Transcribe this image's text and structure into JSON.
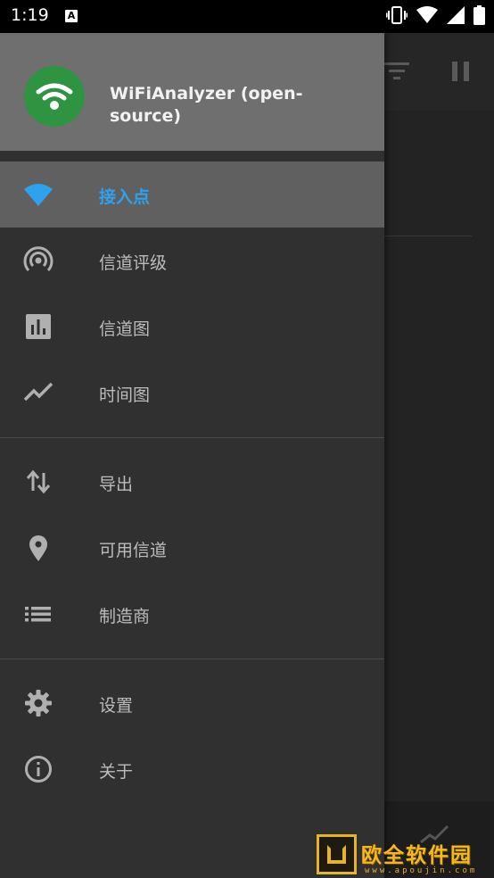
{
  "status_bar": {
    "time": "1:19",
    "notification_badge": "A",
    "icons": [
      "vibrate-icon",
      "wifi-icon",
      "signal-icon",
      "battery-icon"
    ]
  },
  "background_app": {
    "toolbar_icons": [
      "filter-icon",
      "pause-icon"
    ],
    "bottom_icon": "check-icon"
  },
  "drawer": {
    "header": {
      "app_name": "WiFiAnalyzer (open-source)",
      "logo_icon": "wifi-logo-icon",
      "logo_color": "#2e9441"
    },
    "groups": [
      [
        {
          "label": "接入点",
          "icon": "wifi-icon",
          "selected": true
        },
        {
          "label": "信道评级",
          "icon": "radar-icon",
          "selected": false
        },
        {
          "label": "信道图",
          "icon": "bar-chart-icon",
          "selected": false
        },
        {
          "label": "时间图",
          "icon": "line-chart-icon",
          "selected": false
        }
      ],
      [
        {
          "label": "导出",
          "icon": "swap-vertical-icon",
          "selected": false
        },
        {
          "label": "可用信道",
          "icon": "location-pin-icon",
          "selected": false
        },
        {
          "label": "制造商",
          "icon": "list-icon",
          "selected": false
        }
      ],
      [
        {
          "label": "设置",
          "icon": "gear-icon",
          "selected": false
        },
        {
          "label": "关于",
          "icon": "info-icon",
          "selected": false
        }
      ]
    ],
    "accent_color": "#2ea1ef"
  },
  "watermark": {
    "text": "欧全软件园",
    "url": "www.apoujin.com"
  }
}
